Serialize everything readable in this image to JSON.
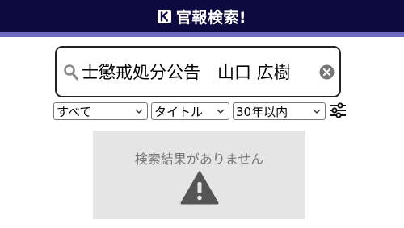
{
  "header": {
    "title": "官報検索!",
    "logo_icon": "k-logo-icon"
  },
  "search": {
    "value": "士懲戒処分公告　山口 広樹",
    "icon": "search-icon",
    "clear_icon": "clear-icon"
  },
  "filters": {
    "category": "すべて",
    "field": "タイトル",
    "period": "30年以内",
    "settings_icon": "sliders-icon"
  },
  "result": {
    "message": "検索結果がありません",
    "icon": "warning-icon"
  },
  "colors": {
    "header_bg": "#0c0a3e",
    "header_border": "#6b69bf",
    "result_bg": "#e5e5e5",
    "result_text": "#777777"
  }
}
